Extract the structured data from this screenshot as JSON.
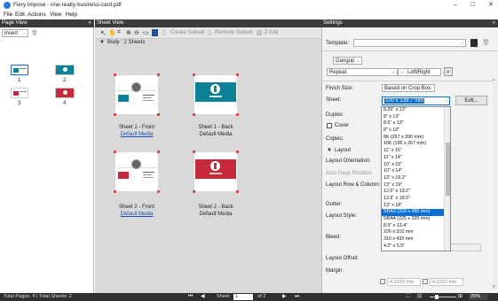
{
  "app": {
    "title": "Fiery Impose - one-realty-business-card.pdf",
    "win_min": "–",
    "win_max": "☐",
    "win_close": "✕"
  },
  "menu": [
    "File",
    "Edit",
    "Actions",
    "View",
    "Help"
  ],
  "page_view": {
    "header": "Page View",
    "collapse": "«",
    "insert_label": "Insert",
    "page_labels": [
      "1",
      "2",
      "3",
      "4"
    ]
  },
  "sheet_view": {
    "header": "Sheet View",
    "toolbar": {
      "create_subset": "Create Subset",
      "remove_subset": "Remove Subset",
      "zfold": "Z-fold"
    },
    "body_label": "Body : 2 Sheets",
    "sheets": [
      {
        "name": "Sheet 1 - Front",
        "media": "Default Media",
        "media_link": true
      },
      {
        "name": "Sheet 1 - Back",
        "media": "Default Media",
        "media_link": false
      },
      {
        "name": "Sheet 2 - Front",
        "media": "Default Media",
        "media_link": true
      },
      {
        "name": "Sheet 2 - Back",
        "media": "Default Media",
        "media_link": false
      }
    ]
  },
  "settings": {
    "header": "Settings",
    "expand": "»",
    "template_label": "Template:",
    "gangup": "Gangup",
    "repeat": "Repeat",
    "orientation": "Left/Right",
    "finish_size_label": "Finish Size:",
    "finish_size_value": "Based on Crop Box",
    "sheet_label": "Sheet:",
    "sheet_value": "100 x 139.7 mm",
    "edit_button": "Edit...",
    "duplex_label": "Duplex:",
    "cover_label": "Cover",
    "copies_label": "Copies:",
    "layout_section": "Layout",
    "layout_orientation": "Layout Orientation:",
    "auto_page_rotation": "Auto Page Rotation",
    "layout_row_column": "Layout Row & Column:",
    "gutter": "Gutter:",
    "layout_style": "Layout Style:",
    "bleed": "Bleed:",
    "layout_offset": "Layout Offset:",
    "margin": "Margin:",
    "margin_value_1": "4.2333 mm",
    "margin_value_2": "4.2333 mm",
    "sheet_options": [
      "8.25\" x 13\"",
      "8\" x 13\"",
      "8.5\" x 13\"",
      "8\" x 10\"",
      "8K (267 x 390 mm)",
      "16K (195 x 267 mm)",
      "11\" x 15\"",
      "11\" x 14\"",
      "10\" x 15\"",
      "10\" x 14\"",
      "13\" x 19.2\"",
      "13\" x 19\"",
      "12.6\" x 19.2\"",
      "12.6\" x 18.5\"",
      "13\" x 18\"",
      "SRA3 (320 x 450 mm)",
      "SRA4 (225 x 320 mm)",
      "8.5\" x 13.4\"",
      "226 x 310 mm",
      "310 x 432 mm",
      "4.2\" x 5.5\""
    ],
    "selected_option_index": 15
  },
  "status": {
    "totals": "Total Pages: 4 | Total Sheets: 2",
    "sheet_word": "Sheet",
    "sheet_num": "1",
    "of_total": "of 2",
    "zoom": "25%"
  },
  "colors": {
    "accent": "#0b6fd1",
    "dark_header": "#3a3a3a",
    "card_teal": "#0e8196",
    "card_red": "#c52a3a"
  }
}
